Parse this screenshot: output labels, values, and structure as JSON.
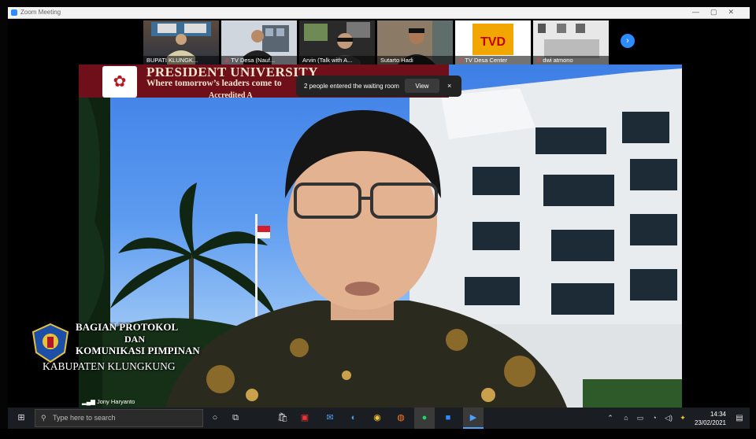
{
  "window": {
    "title": "Zoom Meeting"
  },
  "gallery": [
    {
      "name": "BUPATI KLUNGK...",
      "muted": false
    },
    {
      "name": "TV Desa (Nauf...",
      "muted": true
    },
    {
      "name": "Arvin (Talk with A...",
      "muted": false
    },
    {
      "name": "Sutarto Hadi",
      "muted": false
    },
    {
      "name": "TV Desa Center",
      "muted": true
    },
    {
      "name": "dwi atmono",
      "muted": true
    }
  ],
  "notification": {
    "message": "2 people entered the waiting room",
    "view_label": "View",
    "close_label": "×"
  },
  "speaker": {
    "name": "Jony Haryanto"
  },
  "virtual_background": {
    "university": "PRESIDENT UNIVERSITY",
    "tagline": "Where tomorrow’s leaders come to",
    "accreditation": "Accredited A"
  },
  "watermark": {
    "line1": "BAGIAN PROTOKOL",
    "line2": "DAN",
    "line3": "KOMUNIKASI PIMPINAN",
    "line4": "KABUPATEN KLUNGKUNG"
  },
  "taskbar": {
    "search_placeholder": "Type here to search",
    "time": "14:34",
    "date": "23/02/2021"
  },
  "colors": {
    "zoom_blue": "#2d8cff",
    "banner": "#6e0f1a",
    "taskbar": "#1a1d22"
  }
}
